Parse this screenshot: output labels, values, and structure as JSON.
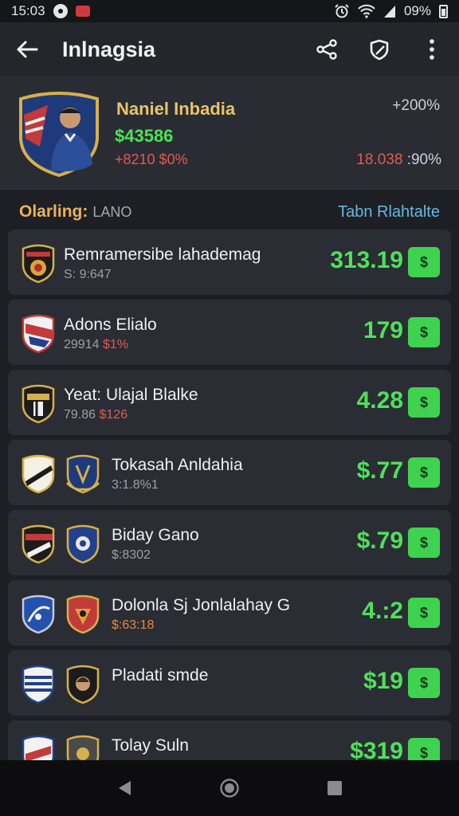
{
  "status_bar": {
    "time": "15:03",
    "battery": "09%"
  },
  "app_bar": {
    "title": "Inlnagsia"
  },
  "hero": {
    "name": "Naniel Inbadia",
    "value": "$43586",
    "change": "+8210 $0%",
    "percent": "+200%",
    "right_value": "18.038",
    "right_pct": ":90%"
  },
  "section": {
    "label": "Olarling:",
    "sub": "LANO",
    "link": "Tabn Rlahtalte"
  },
  "rows": [
    {
      "name": "Remramersibe lahademag",
      "sub_a": "S: 9:647",
      "sub_b": "",
      "price": "313.19",
      "crests": 1
    },
    {
      "name": "Adons Elialo",
      "sub_a": "29914",
      "sub_b": "$1%",
      "price": "179",
      "crests": 1
    },
    {
      "name": "Yeat: Ulajal Blalke",
      "sub_a": "79.86",
      "sub_b": "$126",
      "price": "4.28",
      "crests": 1
    },
    {
      "name": "Tokasah Anldahia",
      "sub_a": "3:1.8%1",
      "sub_b": "",
      "price": "$.77",
      "crests": 2
    },
    {
      "name": "Biday Gano",
      "sub_a": "$:8302",
      "sub_b": "",
      "price": "$.79",
      "crests": 2
    },
    {
      "name": "Dolonla Sj Jonlalahay G",
      "sub_a": "$:63:18",
      "sub_b": "",
      "price": "4.:2",
      "crests": 2
    },
    {
      "name": "Pladati smde",
      "sub_a": "",
      "sub_b": "",
      "price": "$19",
      "crests": 2
    },
    {
      "name": "Tolay Suln",
      "sub_a": "",
      "sub_b": "",
      "price": "$319",
      "crests": 2
    }
  ],
  "buy_label": "$"
}
